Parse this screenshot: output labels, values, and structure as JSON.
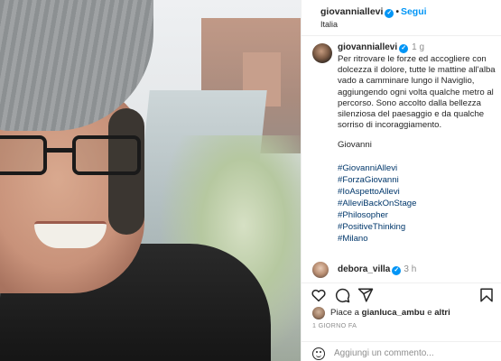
{
  "header": {
    "username": "giovanniallevi",
    "verified_icon": "verified-badge-icon",
    "separator": "•",
    "follow_label": "Segui",
    "location": "Italia"
  },
  "caption": {
    "username": "giovanniallevi",
    "time": "1 g",
    "text": "Per ritrovare le forze ed accogliere con dolcezza il dolore, tutte le mattine all'alba vado a camminare lungo il Naviglio, aggiungendo ogni volta qualche metro al percorso. Sono accolto dalla bellezza silenziosa del paesaggio e da qualche sorriso di incoraggiamento.",
    "signature": "Giovanni",
    "hashtags": [
      "#GiovanniAllevi",
      "#ForzaGiovanni",
      "#IoAspettoAllevi",
      "#AlleviBackOnStage",
      "#Philosopher",
      "#PositiveThinking",
      "#Milano"
    ]
  },
  "comment": {
    "username": "debora_villa",
    "time": "3 h"
  },
  "actions": {
    "like_icon": "heart-icon",
    "comment_icon": "comment-icon",
    "share_icon": "share-icon",
    "save_icon": "bookmark-icon"
  },
  "likes": {
    "prefix": "Piace a",
    "user": "gianluca_ambu",
    "connector": "e",
    "others": "altri"
  },
  "date": "1 GIORNO FA",
  "add_comment": {
    "emoji_icon": "emoji-icon",
    "placeholder": "Aggiungi un commento..."
  },
  "colors": {
    "accent_blue": "#0095f6",
    "hashtag": "#00376b",
    "muted": "#8e8e8e",
    "text": "#262626"
  }
}
